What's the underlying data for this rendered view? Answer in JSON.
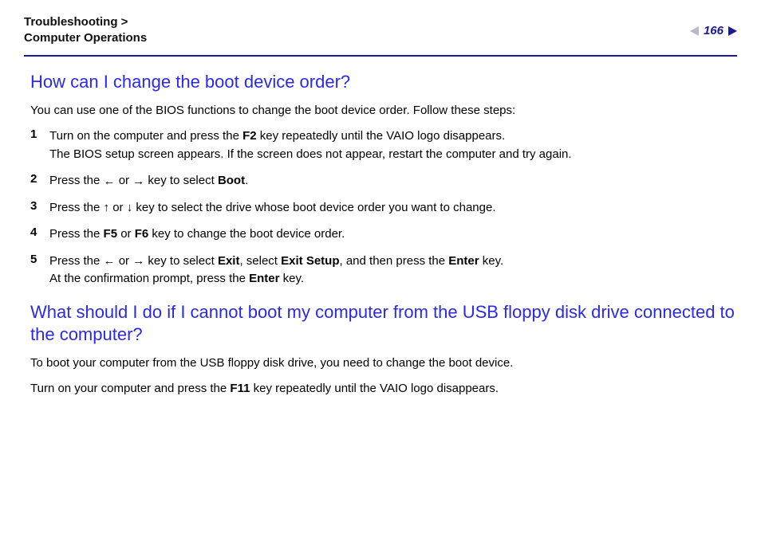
{
  "header": {
    "breadcrumb_line1": "Troubleshooting >",
    "breadcrumb_line2": "Computer Operations",
    "page_number": "166"
  },
  "section1": {
    "title": "How can I change the boot device order?",
    "intro": "You can use one of the BIOS functions to change the boot device order. Follow these steps:",
    "steps": [
      {
        "num": "1",
        "html": "Turn on the computer and press the <b>F2</b> key repeatedly until the VAIO logo disappears.<br>The BIOS setup screen appears. If the screen does not appear, restart the computer and try again."
      },
      {
        "num": "2",
        "html": "Press the <span class='arrow-icon' data-name='left-arrow-icon' data-interactable='false'>←</span> or <span class='arrow-icon' data-name='right-arrow-icon' data-interactable='false'>→</span> key to select <b>Boot</b>."
      },
      {
        "num": "3",
        "html": "Press the <span class='arrow-icon' data-name='up-arrow-icon' data-interactable='false'>↑</span> or <span class='arrow-icon' data-name='down-arrow-icon' data-interactable='false'>↓</span> key to select the drive whose boot device order you want to change."
      },
      {
        "num": "4",
        "html": "Press the <b>F5</b> or <b>F6</b> key to change the boot device order."
      },
      {
        "num": "5",
        "html": "Press the <span class='arrow-icon' data-name='left-arrow-icon' data-interactable='false'>←</span> or <span class='arrow-icon' data-name='right-arrow-icon' data-interactable='false'>→</span> key to select <b>Exit</b>, select <b>Exit Setup</b>, and then press the <b>Enter</b> key.<br>At the confirmation prompt, press the <b>Enter</b> key."
      }
    ]
  },
  "section2": {
    "title": "What should I do if I cannot boot my computer from the USB floppy disk drive connected to the computer?",
    "para1": "To boot your computer from the USB floppy disk drive, you need to change the boot device.",
    "para2_html": "Turn on your computer and press the <b>F11</b> key repeatedly until the VAIO logo disappears."
  }
}
